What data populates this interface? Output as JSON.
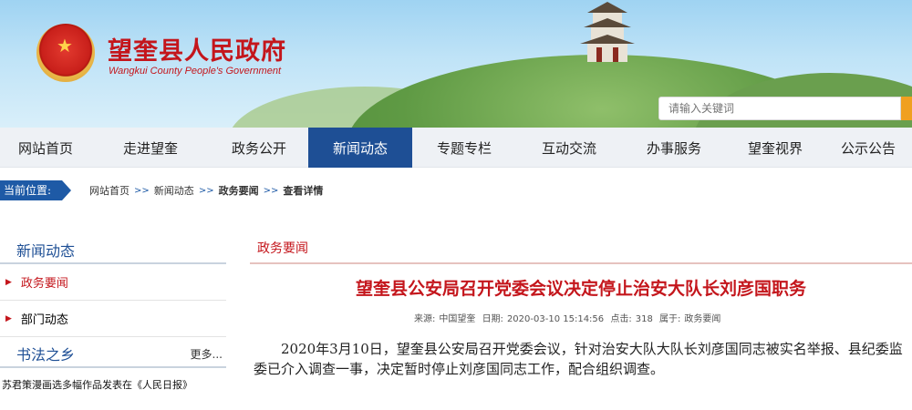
{
  "header": {
    "site_title": "望奎县人民政府",
    "site_subtitle": "Wangkui County People's Government",
    "search_placeholder": "请输入关键词"
  },
  "nav": {
    "items": [
      {
        "label": "网站首页"
      },
      {
        "label": "走进望奎"
      },
      {
        "label": "政务公开"
      },
      {
        "label": "新闻动态",
        "active": true
      },
      {
        "label": "专题专栏"
      },
      {
        "label": "互动交流"
      },
      {
        "label": "办事服务"
      },
      {
        "label": "望奎视界"
      },
      {
        "label": "公示公告"
      }
    ]
  },
  "breadcrumb": {
    "tag": "当前位置:",
    "links": [
      "网站首页",
      "新闻动态",
      "政务要闻",
      "查看详情"
    ],
    "separator": ">>"
  },
  "sidebar": {
    "section_title": "新闻动态",
    "items": [
      {
        "label": "政务要闻",
        "active": true
      },
      {
        "label": "部门动态"
      }
    ],
    "calligraphy_title": "书法之乡",
    "more_label": "更多...",
    "news_item": "苏君策漫画选多幅作品发表在《人民日报》"
  },
  "main": {
    "section_title": "政务要闻",
    "article_title": "望奎县公安局召开党委会议决定停止治安大队长刘彦国职务",
    "meta": {
      "source_label": "来源:",
      "source": "中国望奎",
      "date_label": "日期:",
      "date": "2020-03-10 15:14:56",
      "clicks_label": "点击:",
      "clicks": "318",
      "category_label": "属于:",
      "category": "政务要闻"
    },
    "body": "2020年3月10日，望奎县公安局召开党委会议，针对治安大队大队长刘彦国同志被实名举报、县纪委监委已介入调查一事，决定暂时停止刘彦国同志工作，配合组织调查。"
  },
  "colors": {
    "brand_red": "#c4161c",
    "nav_active": "#1e4f95",
    "crumb_blue": "#1e5aa6"
  }
}
